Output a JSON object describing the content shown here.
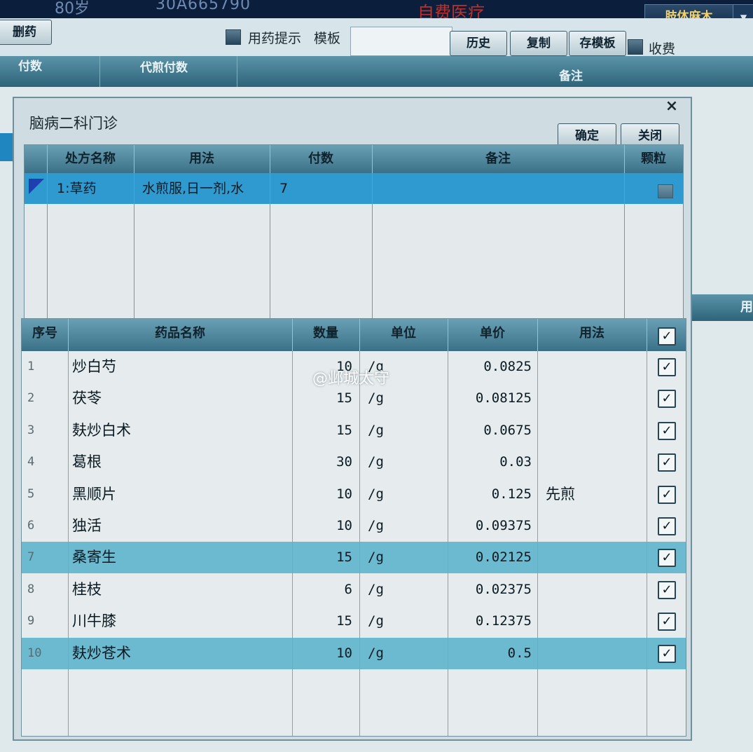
{
  "topbar": {
    "age": "80岁",
    "card_no": "30A665790",
    "payment": "自费医疗",
    "diagnosis": "肢体麻木",
    "dropdown_arrow": "▼"
  },
  "toolbar": {
    "delete_label": "删药",
    "hint_label": "用药提示",
    "template_label": "模板",
    "template_value": "",
    "history_label": "历史",
    "copy_label": "复制",
    "save_template_label": "存模板",
    "charge_label": "收费"
  },
  "background_table": {
    "columns": [
      "付数",
      "代煎付数",
      "备注"
    ],
    "side_label": "用"
  },
  "dialog": {
    "title": "脑病二科门诊",
    "close_glyph": "×",
    "ok_label": "确定",
    "cancel_label": "关闭",
    "prescription": {
      "columns": [
        "处方名称",
        "用法",
        "付数",
        "备注",
        "颗粒"
      ],
      "rows": [
        {
          "name": "1:草药",
          "usage": "水煎服,日一剂,水",
          "doses": "7",
          "note": "",
          "granule": false
        }
      ]
    },
    "drugs": {
      "columns": [
        "序号",
        "药品名称",
        "数量",
        "单位",
        "单价",
        "用法"
      ],
      "check_glyph": "✓",
      "rows": [
        {
          "seq": "1",
          "name": "炒白芍",
          "qty": "10",
          "unit": "/g",
          "price": "0.0825",
          "usage": ""
        },
        {
          "seq": "2",
          "name": "茯苓",
          "qty": "15",
          "unit": "/g",
          "price": "0.08125",
          "usage": ""
        },
        {
          "seq": "3",
          "name": "麸炒白术",
          "qty": "15",
          "unit": "/g",
          "price": "0.0675",
          "usage": ""
        },
        {
          "seq": "4",
          "name": "葛根",
          "qty": "30",
          "unit": "/g",
          "price": "0.03",
          "usage": ""
        },
        {
          "seq": "5",
          "name": "黑顺片",
          "qty": "10",
          "unit": "/g",
          "price": "0.125",
          "usage": "先煎"
        },
        {
          "seq": "6",
          "name": "独活",
          "qty": "10",
          "unit": "/g",
          "price": "0.09375",
          "usage": ""
        },
        {
          "seq": "7",
          "name": "桑寄生",
          "qty": "15",
          "unit": "/g",
          "price": "0.02125",
          "usage": ""
        },
        {
          "seq": "8",
          "name": "桂枝",
          "qty": "6",
          "unit": "/g",
          "price": "0.02375",
          "usage": ""
        },
        {
          "seq": "9",
          "name": "川牛膝",
          "qty": "15",
          "unit": "/g",
          "price": "0.12375",
          "usage": ""
        },
        {
          "seq": "10",
          "name": "麸炒苍术",
          "qty": "10",
          "unit": "/g",
          "price": "0.5",
          "usage": ""
        }
      ]
    }
  },
  "watermark": "@邺城太守"
}
